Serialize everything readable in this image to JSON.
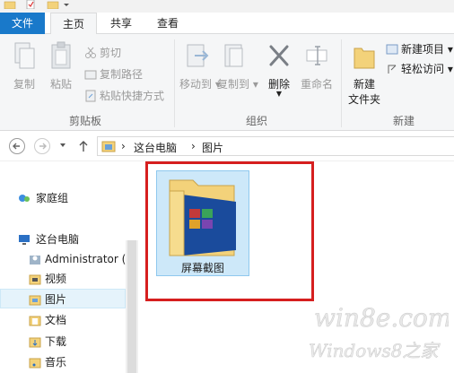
{
  "ribbon": {
    "tabs": [
      {
        "label": "文件"
      },
      {
        "label": "主页"
      },
      {
        "label": "共享"
      },
      {
        "label": "查看"
      }
    ],
    "clipboard": {
      "copy": "复制",
      "paste": "粘贴",
      "cut": "剪切",
      "copy_path": "复制路径",
      "paste_shortcut": "粘贴快捷方式",
      "group_label": "剪贴板"
    },
    "organize": {
      "move_to": "移动到",
      "copy_to": "复制到",
      "delete": "删除",
      "rename": "重命名",
      "group_label": "组织"
    },
    "new": {
      "new_folder_line1": "新建",
      "new_folder_line2": "文件夹",
      "new_item": "新建项目",
      "easy_access": "轻松访问",
      "group_label": "新建"
    }
  },
  "address": {
    "crumbs": [
      "这台电脑",
      "图片"
    ]
  },
  "nav_pane": {
    "homegroup": "家庭组",
    "this_pc": "这台电脑",
    "items": [
      "Administrator (",
      "视频",
      "图片",
      "文档",
      "下载",
      "音乐"
    ]
  },
  "content": {
    "folder_name": "屏幕截图"
  },
  "watermark": {
    "line1": "win8e.com",
    "line2": "Windows8之家"
  },
  "colors": {
    "accent_blue": "#1979ca",
    "highlight_red": "#d61f1f",
    "folder_yellow": "#f3d27a"
  }
}
